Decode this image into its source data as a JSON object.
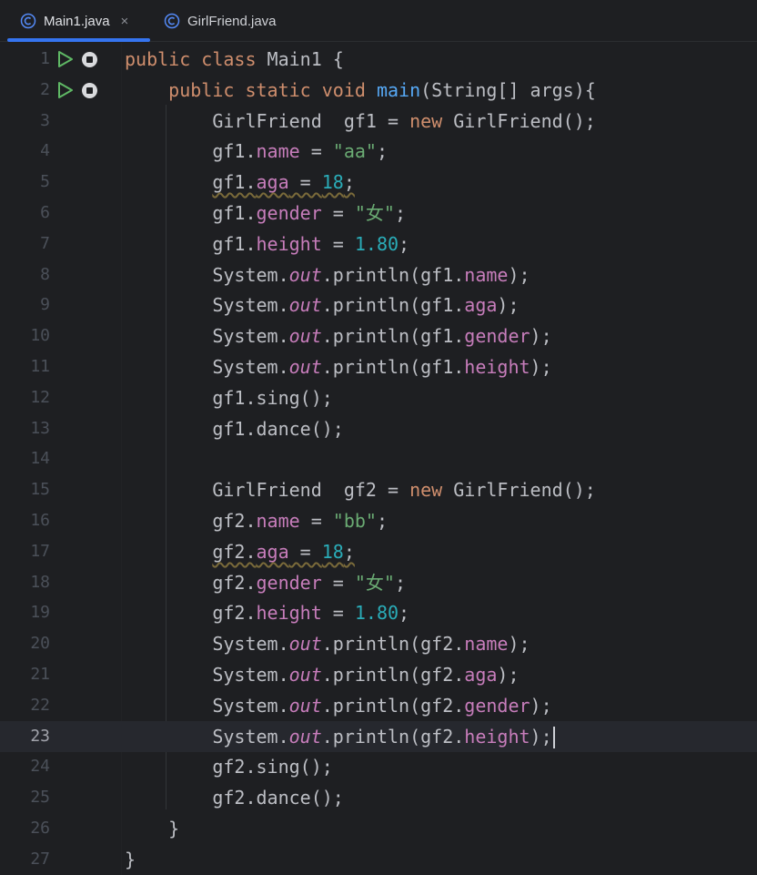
{
  "tabs": [
    {
      "label": "Main1.java",
      "close": "×",
      "icon": "class-icon",
      "active": true
    },
    {
      "label": "GirlFriend.java",
      "icon": "class-icon",
      "active": false
    }
  ],
  "editor": {
    "current_line": 23,
    "lines": [
      {
        "n": "1",
        "t": [
          [
            "kw",
            "public class "
          ],
          [
            "",
            "Main1 {"
          ]
        ],
        "gutter": "run"
      },
      {
        "n": "2",
        "t": [
          [
            "",
            "    "
          ],
          [
            "kw",
            "public static void "
          ],
          [
            "fn",
            "main"
          ],
          [
            "",
            "(String[] args){"
          ]
        ],
        "gutter": "run"
      },
      {
        "n": "3",
        "t": [
          [
            "",
            "        GirlFriend  gf1 = "
          ],
          [
            "kw",
            "new "
          ],
          [
            "",
            "GirlFriend();"
          ]
        ]
      },
      {
        "n": "4",
        "t": [
          [
            "",
            "        gf1."
          ],
          [
            "fld",
            "name"
          ],
          [
            "",
            " = "
          ],
          [
            "str",
            "\"aa\""
          ],
          [
            "",
            ";"
          ]
        ]
      },
      {
        "n": "5",
        "t": [
          [
            "",
            "        "
          ],
          [
            "wavy",
            "gf1."
          ],
          [
            "fld wavy",
            "aga"
          ],
          [
            "wavy",
            " = "
          ],
          [
            "num wavy",
            "18"
          ],
          [
            "wavy",
            ";"
          ]
        ]
      },
      {
        "n": "6",
        "t": [
          [
            "",
            "        gf1."
          ],
          [
            "fld",
            "gender"
          ],
          [
            "",
            " = "
          ],
          [
            "str",
            "\"女\""
          ],
          [
            "",
            ";"
          ]
        ]
      },
      {
        "n": "7",
        "t": [
          [
            "",
            "        gf1."
          ],
          [
            "fld",
            "height"
          ],
          [
            "",
            " = "
          ],
          [
            "num",
            "1.80"
          ],
          [
            "",
            ";"
          ]
        ]
      },
      {
        "n": "8",
        "t": [
          [
            "",
            "        System."
          ],
          [
            "st",
            "out"
          ],
          [
            "",
            ".println(gf1."
          ],
          [
            "fld",
            "name"
          ],
          [
            "",
            ");"
          ]
        ]
      },
      {
        "n": "9",
        "t": [
          [
            "",
            "        System."
          ],
          [
            "st",
            "out"
          ],
          [
            "",
            ".println(gf1."
          ],
          [
            "fld",
            "aga"
          ],
          [
            "",
            ");"
          ]
        ]
      },
      {
        "n": "10",
        "t": [
          [
            "",
            "        System."
          ],
          [
            "st",
            "out"
          ],
          [
            "",
            ".println(gf1."
          ],
          [
            "fld",
            "gender"
          ],
          [
            "",
            ");"
          ]
        ]
      },
      {
        "n": "11",
        "t": [
          [
            "",
            "        System."
          ],
          [
            "st",
            "out"
          ],
          [
            "",
            ".println(gf1."
          ],
          [
            "fld",
            "height"
          ],
          [
            "",
            ");"
          ]
        ]
      },
      {
        "n": "12",
        "t": [
          [
            "",
            "        gf1.sing();"
          ]
        ]
      },
      {
        "n": "13",
        "t": [
          [
            "",
            "        gf1.dance();"
          ]
        ]
      },
      {
        "n": "14",
        "t": [
          [
            "",
            ""
          ]
        ]
      },
      {
        "n": "15",
        "t": [
          [
            "",
            "        GirlFriend  gf2 = "
          ],
          [
            "kw",
            "new "
          ],
          [
            "",
            "GirlFriend();"
          ]
        ]
      },
      {
        "n": "16",
        "t": [
          [
            "",
            "        gf2."
          ],
          [
            "fld",
            "name"
          ],
          [
            "",
            " = "
          ],
          [
            "str",
            "\"bb\""
          ],
          [
            "",
            ";"
          ]
        ]
      },
      {
        "n": "17",
        "t": [
          [
            "",
            "        "
          ],
          [
            "wavy",
            "gf2."
          ],
          [
            "fld wavy",
            "aga"
          ],
          [
            "wavy",
            " = "
          ],
          [
            "num wavy",
            "18"
          ],
          [
            "wavy",
            ";"
          ]
        ]
      },
      {
        "n": "18",
        "t": [
          [
            "",
            "        gf2."
          ],
          [
            "fld",
            "gender"
          ],
          [
            "",
            " = "
          ],
          [
            "str",
            "\"女\""
          ],
          [
            "",
            ";"
          ]
        ]
      },
      {
        "n": "19",
        "t": [
          [
            "",
            "        gf2."
          ],
          [
            "fld",
            "height"
          ],
          [
            "",
            " = "
          ],
          [
            "num",
            "1.80"
          ],
          [
            "",
            ";"
          ]
        ]
      },
      {
        "n": "20",
        "t": [
          [
            "",
            "        System."
          ],
          [
            "st",
            "out"
          ],
          [
            "",
            ".println(gf2."
          ],
          [
            "fld",
            "name"
          ],
          [
            "",
            ");"
          ]
        ]
      },
      {
        "n": "21",
        "t": [
          [
            "",
            "        System."
          ],
          [
            "st",
            "out"
          ],
          [
            "",
            ".println(gf2."
          ],
          [
            "fld",
            "aga"
          ],
          [
            "",
            ");"
          ]
        ]
      },
      {
        "n": "22",
        "t": [
          [
            "",
            "        System."
          ],
          [
            "st",
            "out"
          ],
          [
            "",
            ".println(gf2."
          ],
          [
            "fld",
            "gender"
          ],
          [
            "",
            ");"
          ]
        ]
      },
      {
        "n": "23",
        "t": [
          [
            "",
            "        System."
          ],
          [
            "st",
            "out"
          ],
          [
            "",
            ".println(gf2."
          ],
          [
            "fld",
            "height"
          ],
          [
            "",
            ");"
          ]
        ],
        "caret": true
      },
      {
        "n": "24",
        "t": [
          [
            "",
            "        gf2.sing();"
          ]
        ]
      },
      {
        "n": "25",
        "t": [
          [
            "",
            "        gf2.dance();"
          ]
        ]
      },
      {
        "n": "26",
        "t": [
          [
            "",
            "    }"
          ]
        ]
      },
      {
        "n": "27",
        "t": [
          [
            "",
            "}"
          ]
        ]
      }
    ]
  },
  "colors": {
    "background": "#1e1f22",
    "keyword": "#cf8e6d",
    "method": "#56a8f5",
    "field": "#c77dbb",
    "string": "#6aab73",
    "number": "#2aacb8",
    "accent": "#3574f0"
  }
}
